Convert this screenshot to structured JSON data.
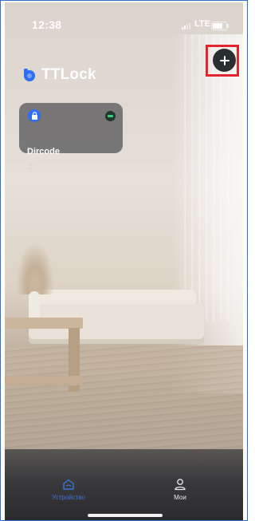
{
  "status_bar": {
    "time": "12:38",
    "network": "LTE",
    "battery_level": 0.8
  },
  "header": {
    "app_name": "TTLock",
    "brand_color": "#2f6ef0",
    "add_button_icon": "plus-icon",
    "highlight_color": "#e1262f"
  },
  "devices": [
    {
      "name": "Dircode",
      "lock_icon": "padlock-icon",
      "battery_icon": "battery-indicator-icon",
      "battery_color": "#36d27e",
      "user_icon": "user-icon"
    }
  ],
  "bottom_nav": {
    "items": [
      {
        "label": "Устройство",
        "icon": "home-icon",
        "active": true,
        "color": "#3d73d8"
      },
      {
        "label": "Мои",
        "icon": "person-icon",
        "active": false,
        "color": "#e9e9ea"
      }
    ]
  }
}
